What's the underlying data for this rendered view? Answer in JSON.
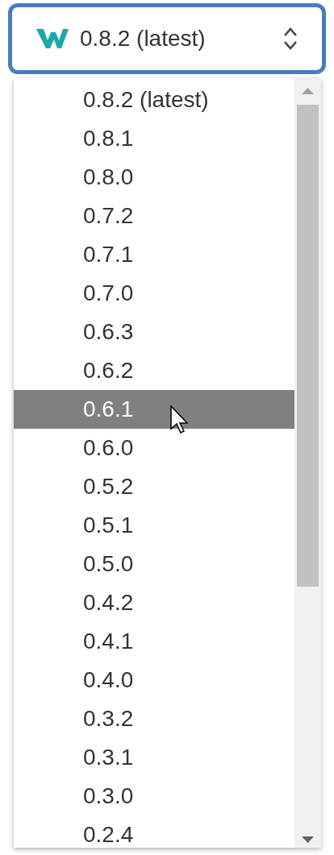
{
  "select": {
    "value": "0.8.2 (latest)"
  },
  "options": [
    {
      "label": "0.8.2 (latest)",
      "selected": false
    },
    {
      "label": "0.8.1",
      "selected": false
    },
    {
      "label": "0.8.0",
      "selected": false
    },
    {
      "label": "0.7.2",
      "selected": false
    },
    {
      "label": "0.7.1",
      "selected": false
    },
    {
      "label": "0.7.0",
      "selected": false
    },
    {
      "label": "0.6.3",
      "selected": false
    },
    {
      "label": "0.6.2",
      "selected": false
    },
    {
      "label": "0.6.1",
      "selected": true
    },
    {
      "label": "0.6.0",
      "selected": false
    },
    {
      "label": "0.5.2",
      "selected": false
    },
    {
      "label": "0.5.1",
      "selected": false
    },
    {
      "label": "0.5.0",
      "selected": false
    },
    {
      "label": "0.4.2",
      "selected": false
    },
    {
      "label": "0.4.1",
      "selected": false
    },
    {
      "label": "0.4.0",
      "selected": false
    },
    {
      "label": "0.3.2",
      "selected": false
    },
    {
      "label": "0.3.1",
      "selected": false
    },
    {
      "label": "0.3.0",
      "selected": false
    },
    {
      "label": "0.2.4",
      "selected": false
    }
  ]
}
